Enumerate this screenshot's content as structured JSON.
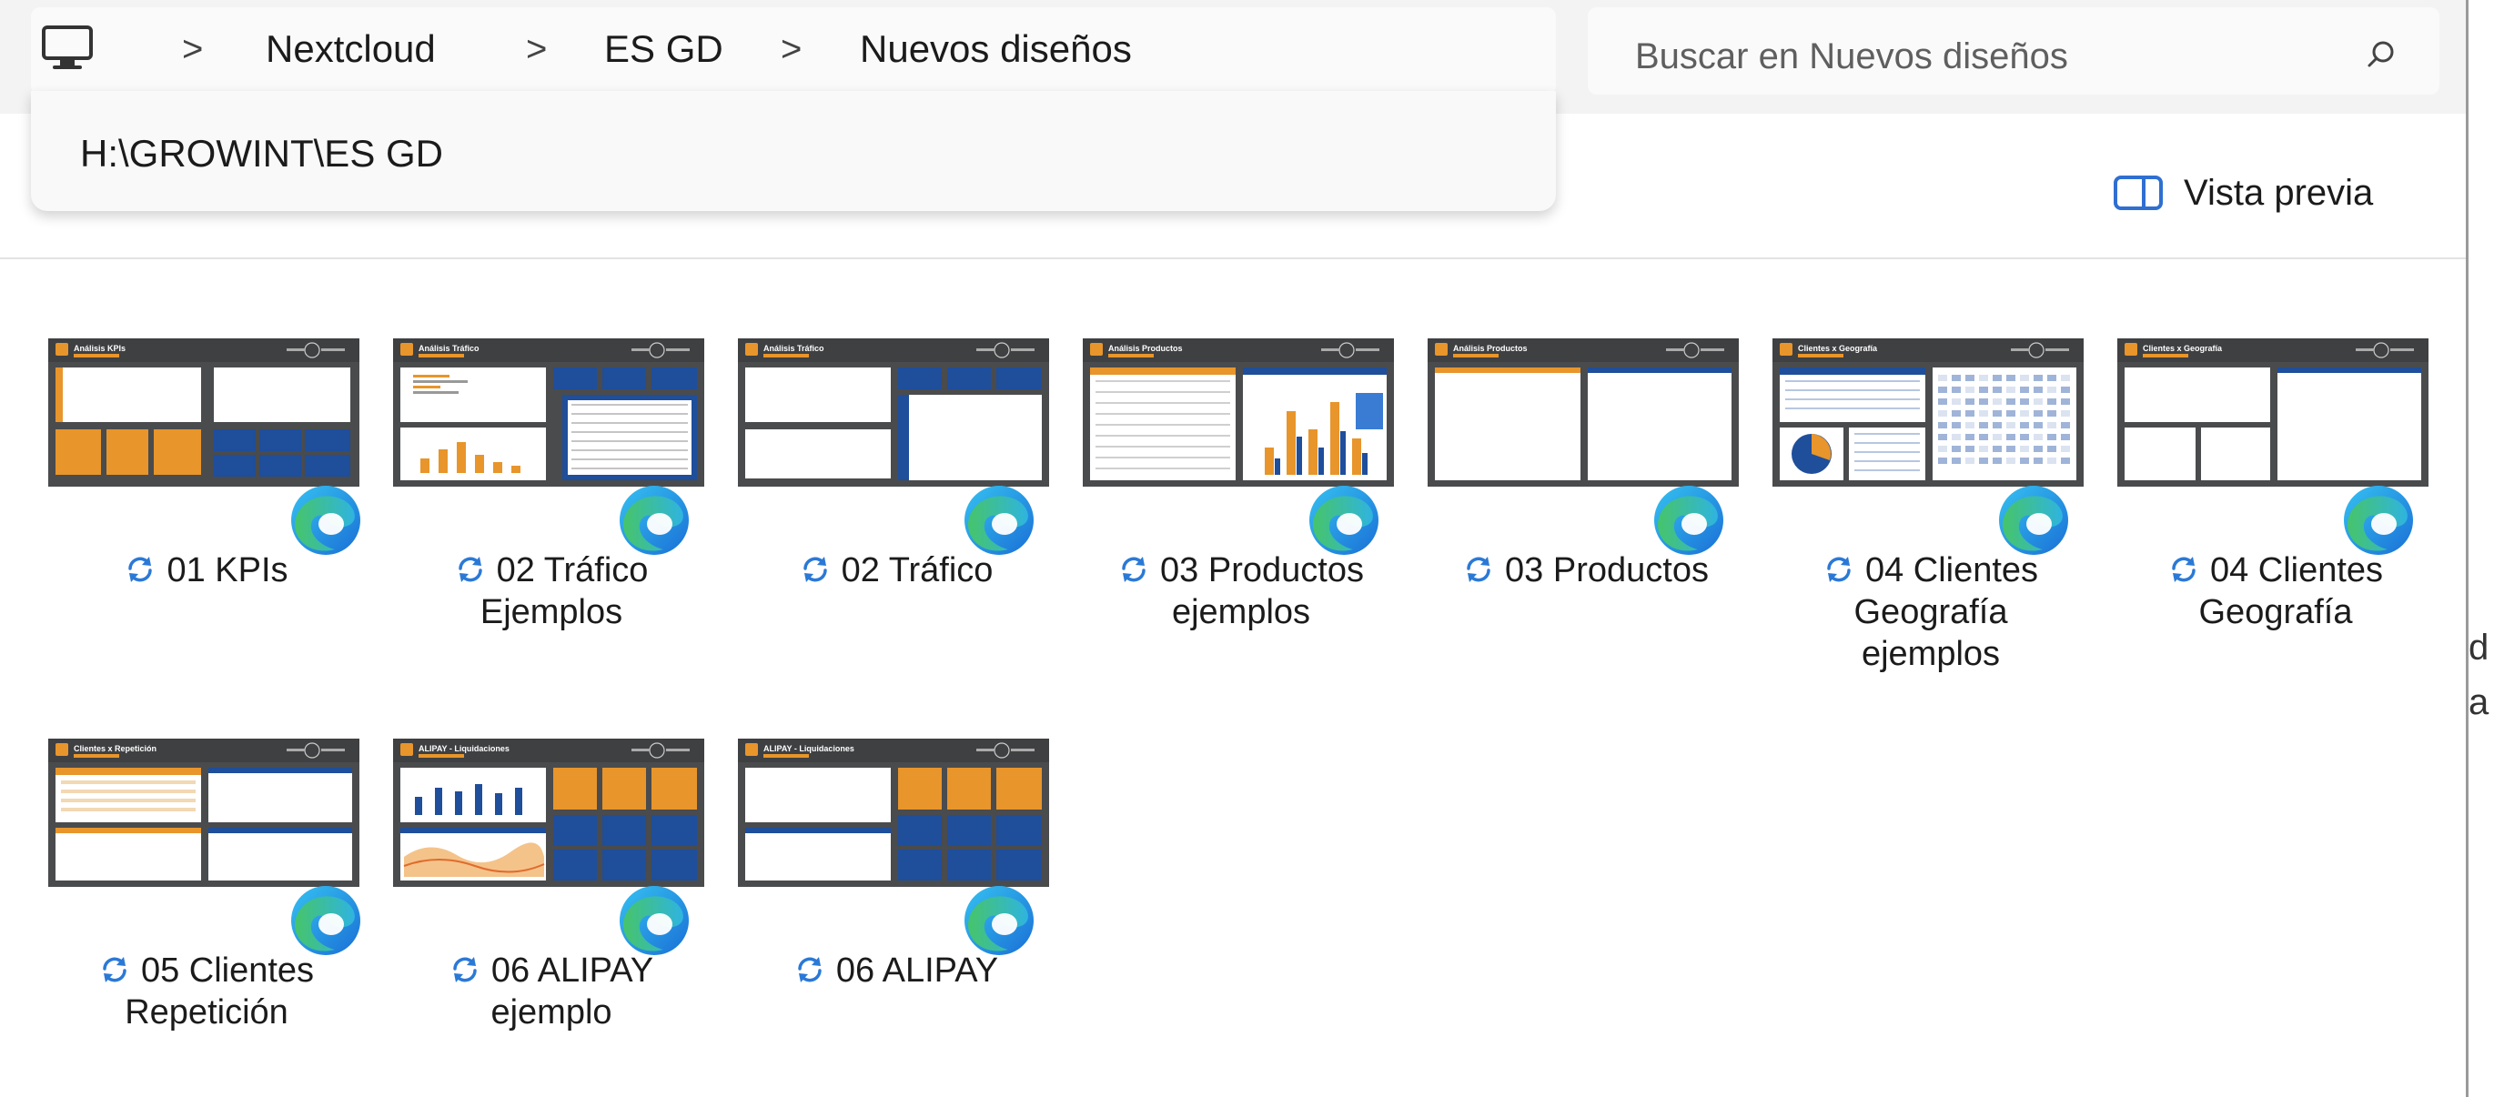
{
  "breadcrumb": {
    "items": [
      "Nextcloud",
      "ES GD",
      "Nuevos diseños"
    ],
    "separator": ">"
  },
  "address_dropdown": {
    "path": "H:\\GROWINT\\ES GD"
  },
  "search": {
    "placeholder": "Buscar en Nuevos diseños"
  },
  "commandbar": {
    "preview_label": "Vista previa"
  },
  "files": [
    {
      "line1": "01 KPIs",
      "line2": "",
      "line3": "",
      "thumbnail": "kpis"
    },
    {
      "line1": "02 Tráfico",
      "line2": "Ejemplos",
      "line3": "",
      "thumbnail": "trafico-ejemplos"
    },
    {
      "line1": "02 Tráfico",
      "line2": "",
      "line3": "",
      "thumbnail": "trafico"
    },
    {
      "line1": "03 Productos",
      "line2": "ejemplos",
      "line3": "",
      "thumbnail": "productos-ejemplos"
    },
    {
      "line1": "03 Productos",
      "line2": "",
      "line3": "",
      "thumbnail": "productos"
    },
    {
      "line1": "04 Clientes",
      "line2": "Geografía",
      "line3": "ejemplos",
      "thumbnail": "geografia-ejemplos"
    },
    {
      "line1": "04 Clientes",
      "line2": "Geografía",
      "line3": "",
      "thumbnail": "geografia"
    },
    {
      "line1": "05 Clientes",
      "line2": "Repetición",
      "line3": "",
      "thumbnail": "repeticion"
    },
    {
      "line1": "06 ALIPAY",
      "line2": "ejemplo",
      "line3": "",
      "thumbnail": "alipay-ejemplo"
    },
    {
      "line1": "06 ALIPAY",
      "line2": "",
      "line3": "",
      "thumbnail": "alipay"
    }
  ],
  "icons": {
    "file_app_badge": "edge-browser-icon",
    "sync_status": "sync-icon",
    "location": "monitor-icon",
    "search": "search-icon",
    "preview": "preview-pane-icon"
  },
  "colors": {
    "thumb_bg": "#4a4b4d",
    "thumb_orange": "#e8952b",
    "thumb_blue": "#1f4e9b",
    "sync_blue": "#2b79d6"
  }
}
